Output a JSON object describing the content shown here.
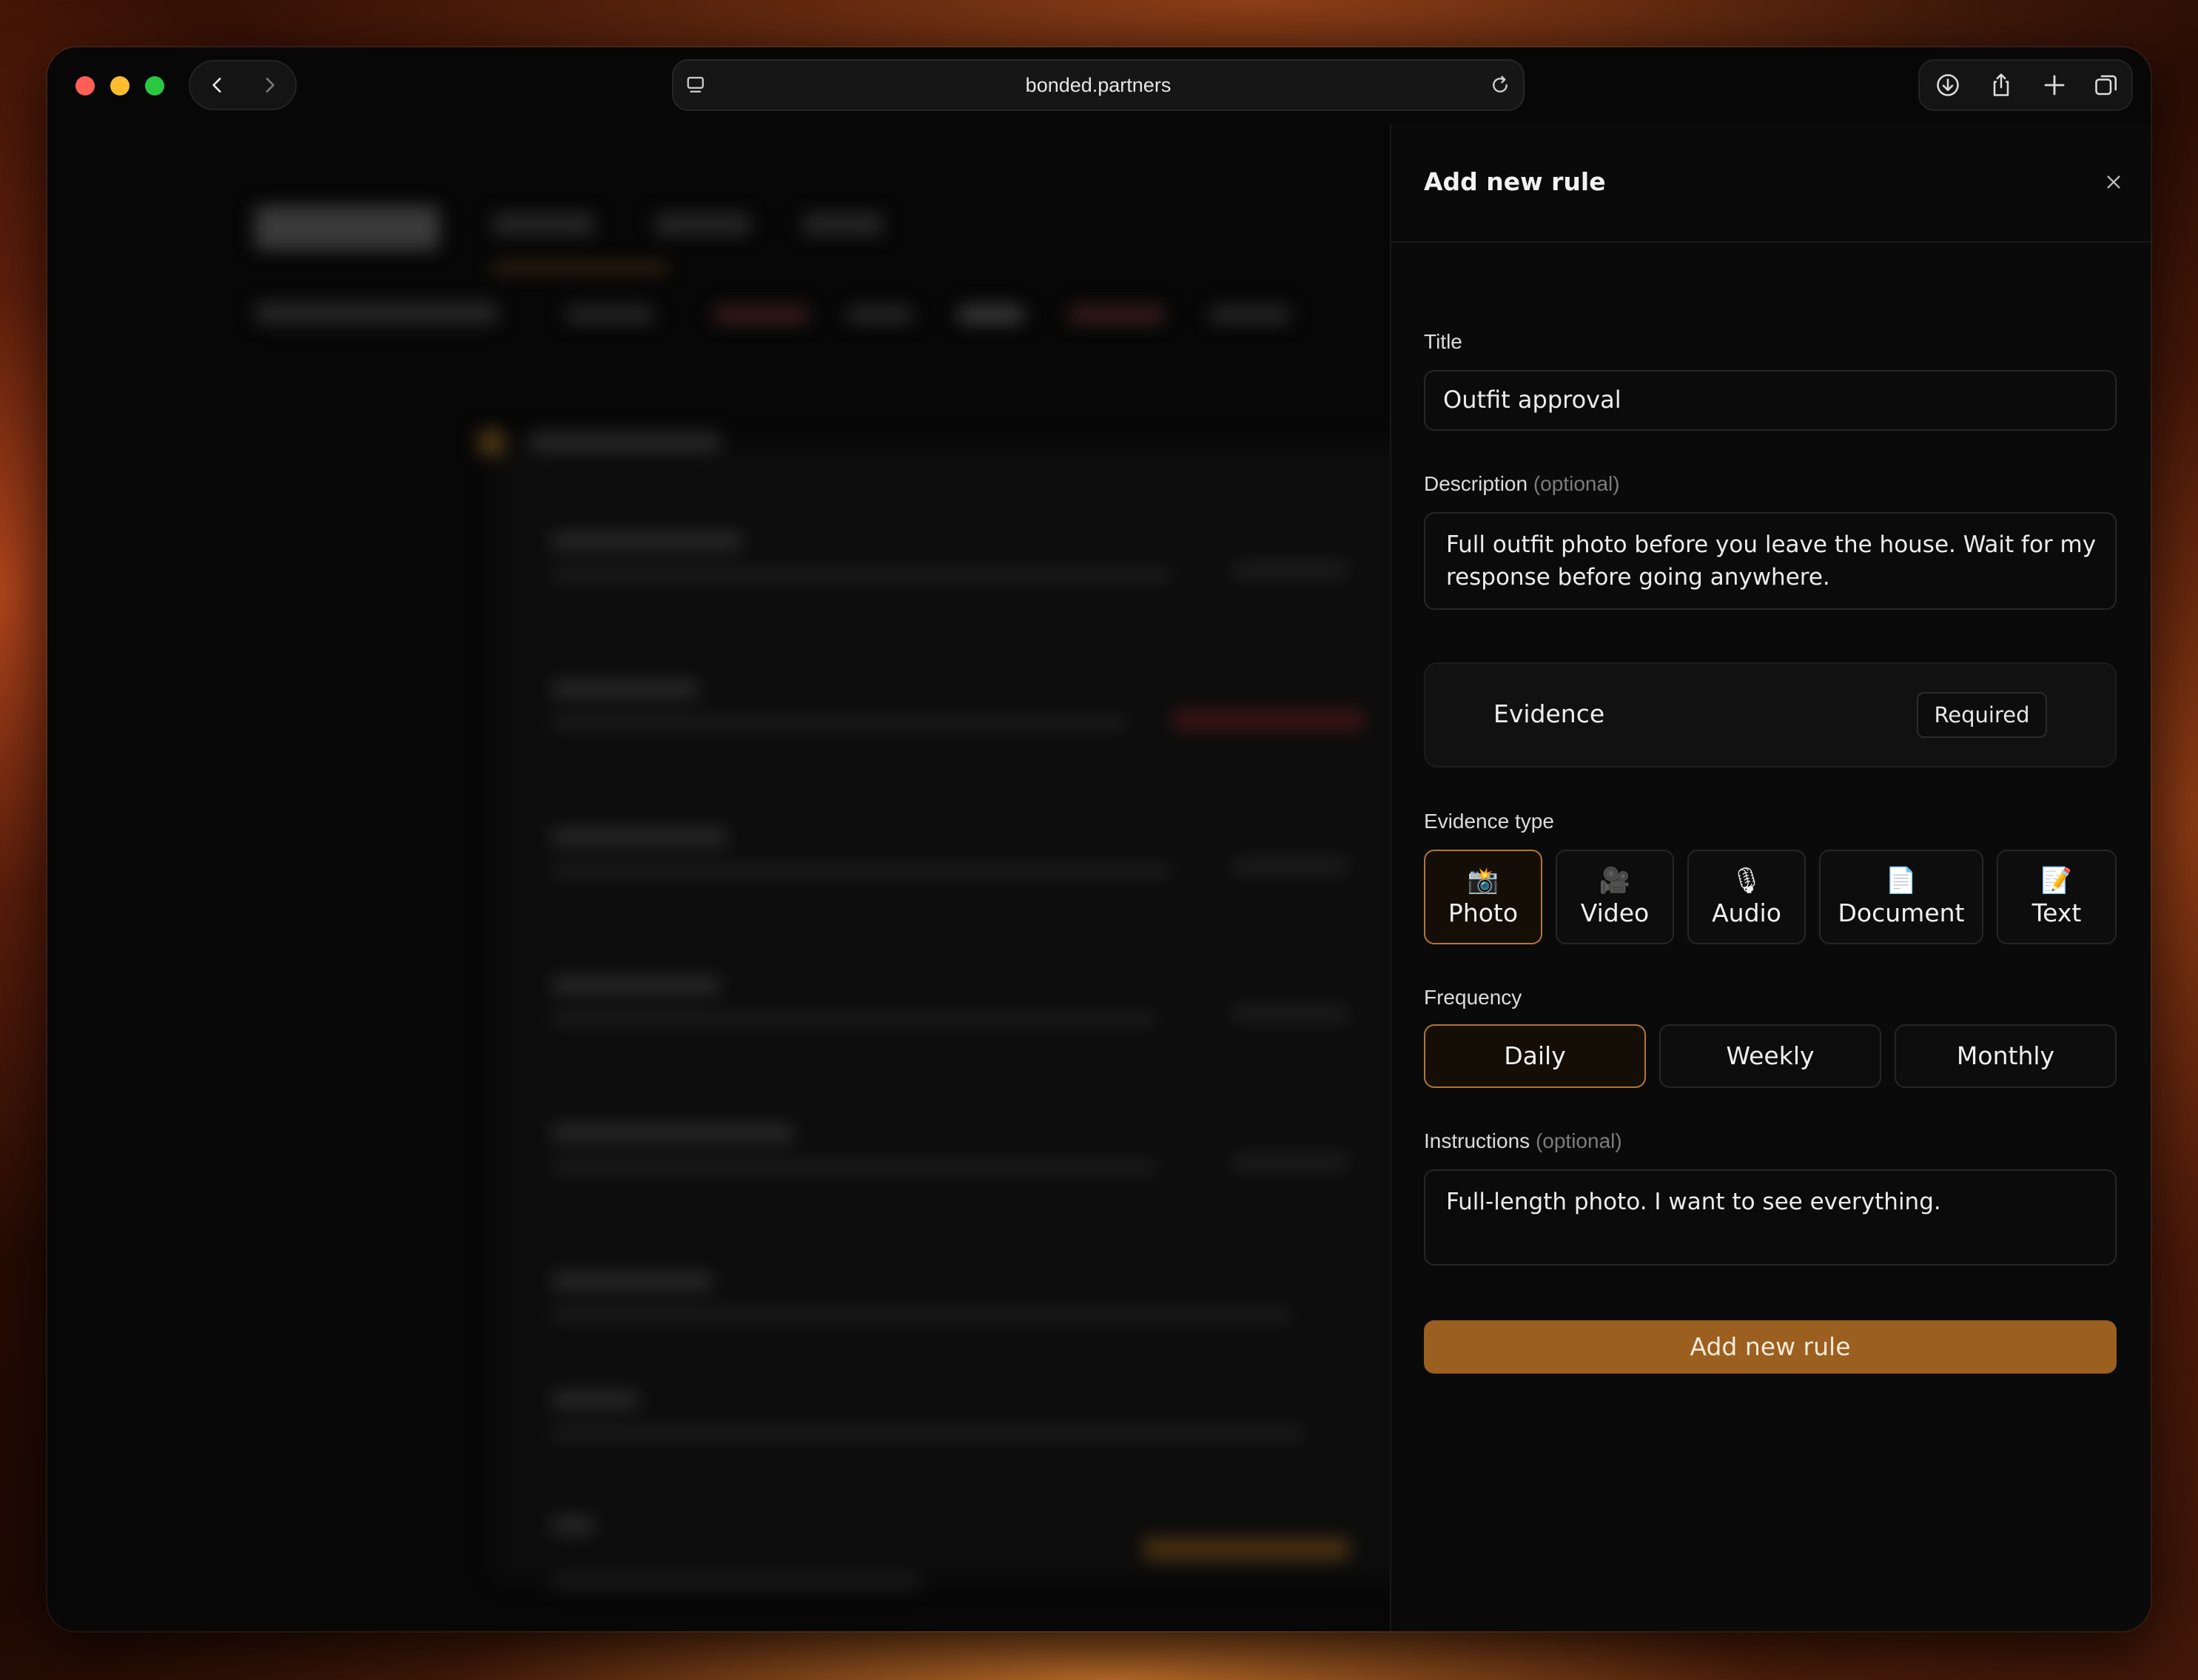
{
  "browser": {
    "url": "bonded.partners"
  },
  "drawer": {
    "title": "Add new rule",
    "title_label": "Title",
    "title_value": "Outfit approval",
    "description_label": "Description",
    "description_optional": "(optional)",
    "description_value": "Full outfit photo before you leave the house. Wait for my response before going anywhere.",
    "evidence_label": "Evidence",
    "evidence_required": "Required",
    "evidence_type_label": "Evidence type",
    "evidence_types": [
      {
        "label": "Photo",
        "icon": "camera-flash-icon",
        "glyph": "📸",
        "selected": true
      },
      {
        "label": "Video",
        "icon": "video-camera-icon",
        "glyph": "🎥",
        "selected": false
      },
      {
        "label": "Audio",
        "icon": "microphone-icon",
        "glyph": "🎙",
        "selected": false
      },
      {
        "label": "Document",
        "icon": "document-icon",
        "glyph": "📄",
        "selected": false
      },
      {
        "label": "Text",
        "icon": "memo-icon",
        "glyph": "📝",
        "selected": false
      }
    ],
    "frequency_label": "Frequency",
    "frequencies": [
      {
        "label": "Daily",
        "selected": true
      },
      {
        "label": "Weekly",
        "selected": false
      },
      {
        "label": "Monthly",
        "selected": false
      }
    ],
    "instructions_label": "Instructions",
    "instructions_optional": "(optional)",
    "instructions_value": "Full-length photo. I want to see everything.",
    "submit_label": "Add new rule"
  },
  "colors": {
    "accent": "#9b5f1f",
    "accent_border": "#b37534",
    "panel_bg": "#0a0a0a"
  }
}
